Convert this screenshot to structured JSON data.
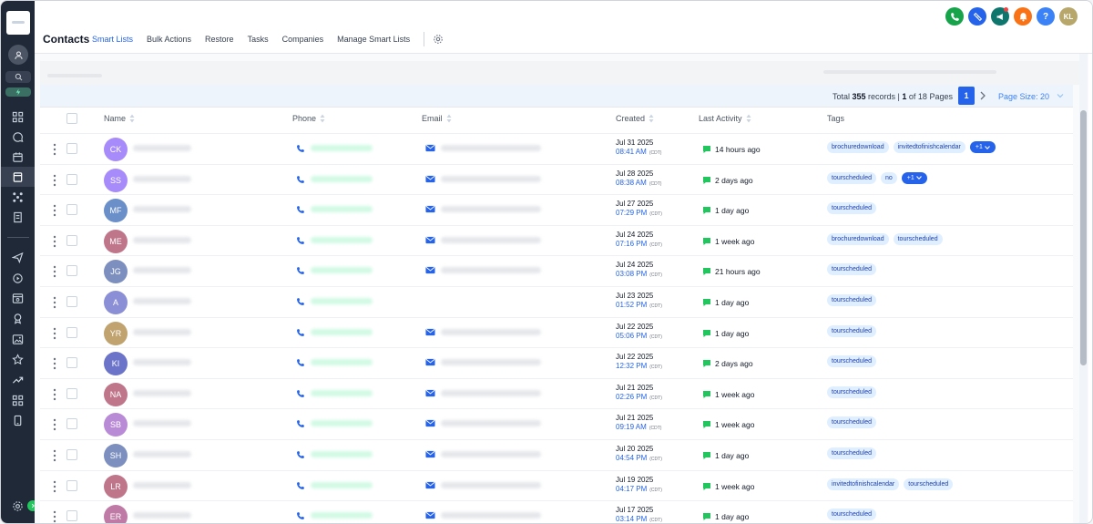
{
  "header": {
    "title": "Contacts",
    "tabs": [
      {
        "label": "Smart Lists",
        "active": true
      },
      {
        "label": "Bulk Actions"
      },
      {
        "label": "Restore"
      },
      {
        "label": "Tasks"
      },
      {
        "label": "Companies"
      },
      {
        "label": "Manage Smart Lists"
      }
    ],
    "user_initials": "KL",
    "help_label": "?"
  },
  "pager": {
    "total_prefix": "Total ",
    "total": "355",
    "total_suffix": " records | ",
    "page": "1",
    "of_text": " of 18 Pages",
    "current_page": "1",
    "page_size": "Page Size: 20"
  },
  "columns": {
    "name": "Name",
    "phone": "Phone",
    "email": "Email",
    "created": "Created",
    "last_activity": "Last Activity",
    "tags": "Tags"
  },
  "colors": {
    "accent": "#2563eb",
    "sidebar": "#1f2937"
  },
  "rows": [
    {
      "initials": "CK",
      "color": "#a78bfa",
      "has_email": true,
      "date": "Jul 31 2025",
      "time": "08:41 AM",
      "tz": "(CDT)",
      "activity": "14 hours ago",
      "tags": [
        "brochuredownload",
        "invitedtofinishcalendar"
      ],
      "more": "+1"
    },
    {
      "initials": "SS",
      "color": "#a78bfa",
      "has_email": true,
      "date": "Jul 28 2025",
      "time": "08:38 AM",
      "tz": "(CDT)",
      "activity": "2 days ago",
      "tags": [
        "tourscheduled",
        "no"
      ],
      "more": "+1"
    },
    {
      "initials": "MF",
      "color": "#6b8fc9",
      "has_email": true,
      "date": "Jul 27 2025",
      "time": "07:29 PM",
      "tz": "(CDT)",
      "activity": "1 day ago",
      "tags": [
        "tourscheduled"
      ]
    },
    {
      "initials": "ME",
      "color": "#c0768a",
      "has_email": true,
      "date": "Jul 24 2025",
      "time": "07:16 PM",
      "tz": "(CDT)",
      "activity": "1 week ago",
      "tags": [
        "brochuredownload",
        "tourscheduled"
      ]
    },
    {
      "initials": "JG",
      "color": "#7c8fbf",
      "has_email": true,
      "date": "Jul 24 2025",
      "time": "03:08 PM",
      "tz": "(CDT)",
      "activity": "21 hours ago",
      "tags": [
        "tourscheduled"
      ]
    },
    {
      "initials": "A",
      "color": "#8a8fd6",
      "has_email": false,
      "date": "Jul 23 2025",
      "time": "01:52 PM",
      "tz": "(CDT)",
      "activity": "1 day ago",
      "tags": [
        "tourscheduled"
      ]
    },
    {
      "initials": "YR",
      "color": "#c0a36e",
      "has_email": true,
      "date": "Jul 22 2025",
      "time": "05:06 PM",
      "tz": "(CDT)",
      "activity": "1 day ago",
      "tags": [
        "tourscheduled"
      ]
    },
    {
      "initials": "KI",
      "color": "#6b74c9",
      "has_email": true,
      "date": "Jul 22 2025",
      "time": "12:32 PM",
      "tz": "(CDT)",
      "activity": "2 days ago",
      "tags": [
        "tourscheduled"
      ]
    },
    {
      "initials": "NA",
      "color": "#c0768a",
      "has_email": true,
      "date": "Jul 21 2025",
      "time": "02:26 PM",
      "tz": "(CDT)",
      "activity": "1 week ago",
      "tags": [
        "tourscheduled"
      ]
    },
    {
      "initials": "SB",
      "color": "#b98ad6",
      "has_email": true,
      "date": "Jul 21 2025",
      "time": "09:19 AM",
      "tz": "(CDT)",
      "activity": "1 week ago",
      "tags": [
        "tourscheduled"
      ]
    },
    {
      "initials": "SH",
      "color": "#7c8fbf",
      "has_email": true,
      "date": "Jul 20 2025",
      "time": "04:54 PM",
      "tz": "(CDT)",
      "activity": "1 day ago",
      "tags": [
        "tourscheduled"
      ]
    },
    {
      "initials": "LR",
      "color": "#c0768a",
      "has_email": true,
      "date": "Jul 19 2025",
      "time": "04:17 PM",
      "tz": "(CDT)",
      "activity": "1 week ago",
      "tags": [
        "invitedtofinishcalendar",
        "tourscheduled"
      ]
    },
    {
      "initials": "ER",
      "color": "#c07aa6",
      "has_email": true,
      "date": "Jul 17 2025",
      "time": "03:14 PM",
      "tz": "(CDT)",
      "activity": "1 day ago",
      "tags": [
        "tourscheduled"
      ]
    }
  ]
}
